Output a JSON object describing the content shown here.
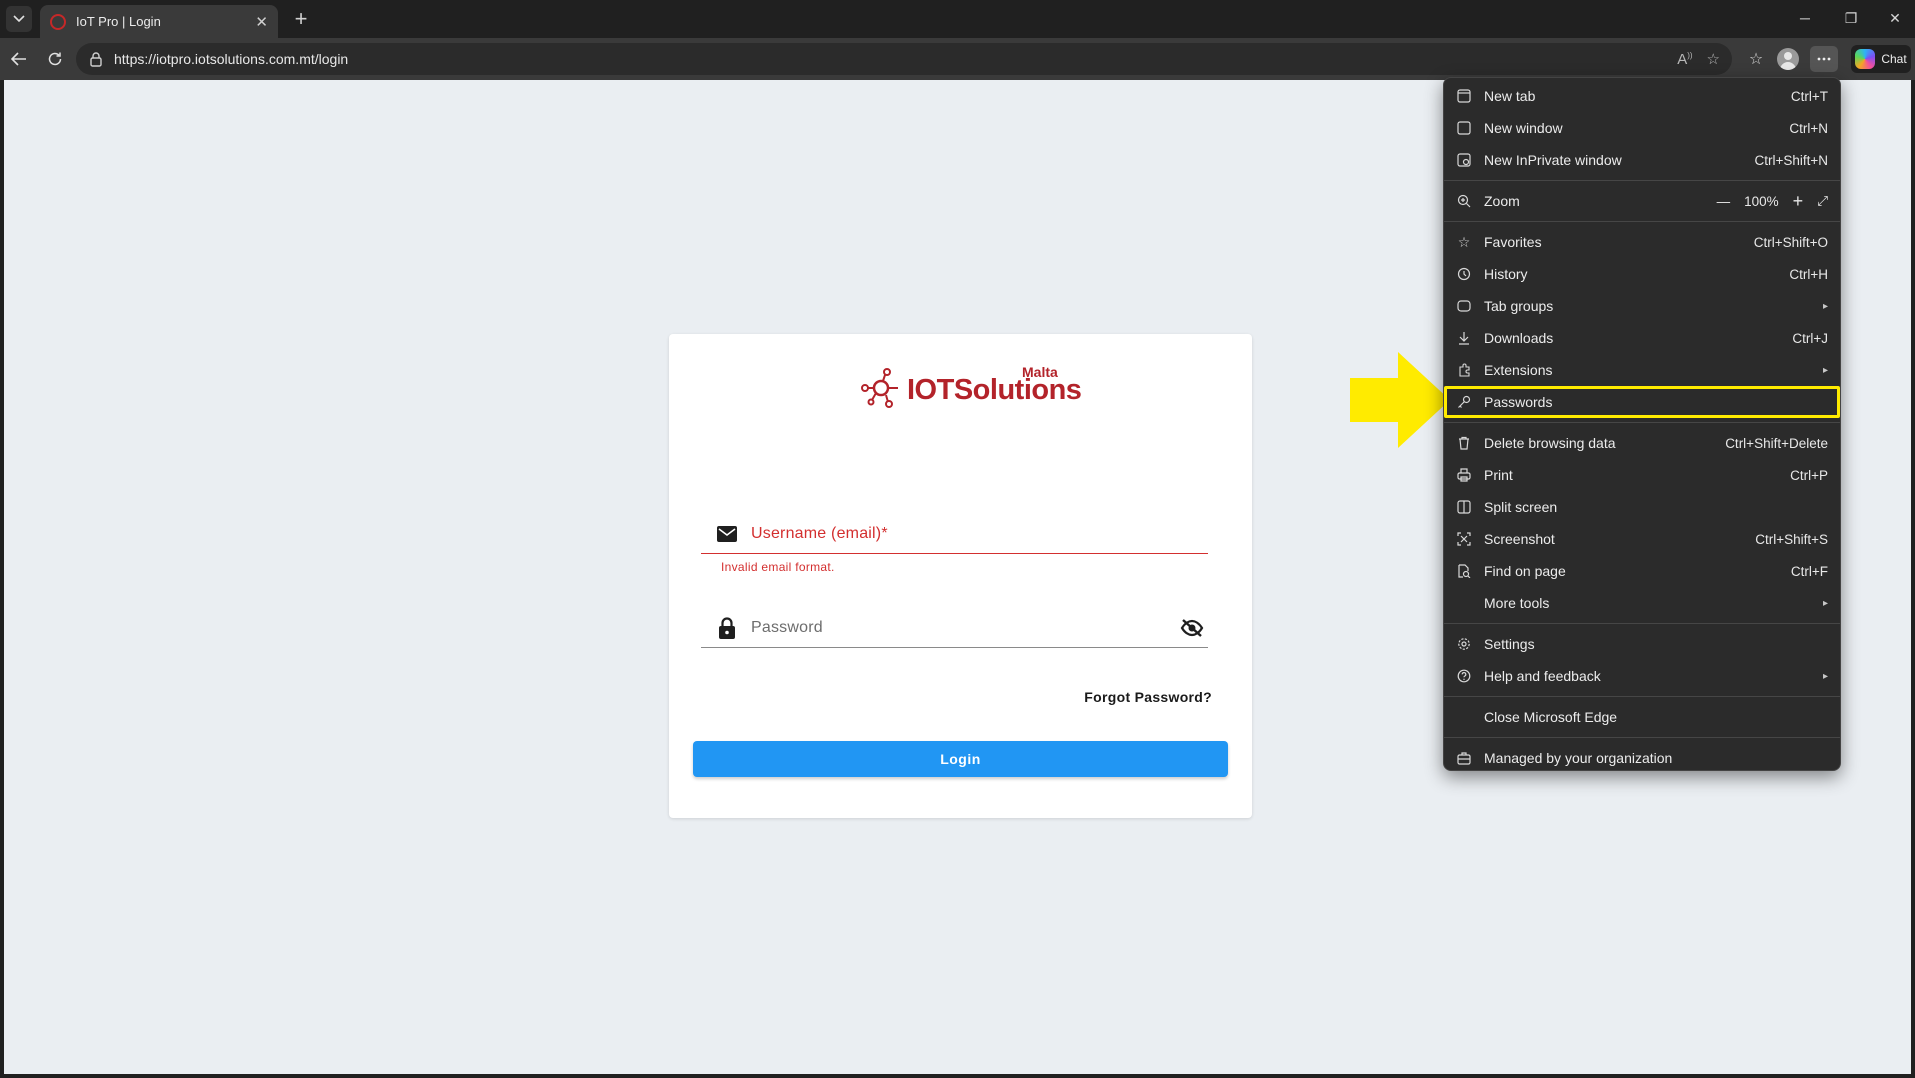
{
  "browser": {
    "tab_title": "IoT Pro | Login",
    "tab_close": "✕",
    "new_tab": "+",
    "url": "https://iotpro.iotsolutions.com.mt/login",
    "chat_label": "Chat",
    "win_min": "─",
    "win_restore": "❐",
    "win_close": "✕"
  },
  "login": {
    "logo_text": "IOTSolutions",
    "logo_sub": "Malta",
    "username_label": "Username (email)*",
    "username_error": "Invalid email format.",
    "password_label": "Password",
    "forgot_label": "Forgot Password?",
    "login_button": "Login"
  },
  "menu": {
    "items_top": [
      {
        "label": "New tab",
        "shortcut": "Ctrl+T",
        "icon": "new-tab-icon"
      },
      {
        "label": "New window",
        "shortcut": "Ctrl+N",
        "icon": "new-window-icon"
      },
      {
        "label": "New InPrivate window",
        "shortcut": "Ctrl+Shift+N",
        "icon": "inprivate-icon"
      }
    ],
    "zoom": {
      "label": "Zoom",
      "value": "100%",
      "minus": "—",
      "plus": "+",
      "expand": "⤢"
    },
    "items_mid": [
      {
        "label": "Favorites",
        "shortcut": "Ctrl+Shift+O",
        "icon": "favorites-icon"
      },
      {
        "label": "History",
        "shortcut": "Ctrl+H",
        "icon": "history-icon"
      },
      {
        "label": "Tab groups",
        "shortcut": "",
        "icon": "tab-groups-icon",
        "submenu": true
      },
      {
        "label": "Downloads",
        "shortcut": "Ctrl+J",
        "icon": "downloads-icon"
      },
      {
        "label": "Extensions",
        "shortcut": "",
        "icon": "extensions-icon",
        "submenu": true
      },
      {
        "label": "Passwords",
        "shortcut": "",
        "icon": "key-icon",
        "highlighted": true
      }
    ],
    "items_tools": [
      {
        "label": "Delete browsing data",
        "shortcut": "Ctrl+Shift+Delete",
        "icon": "trash-icon"
      },
      {
        "label": "Print",
        "shortcut": "Ctrl+P",
        "icon": "print-icon"
      },
      {
        "label": "Split screen",
        "shortcut": "",
        "icon": "split-screen-icon"
      },
      {
        "label": "Screenshot",
        "shortcut": "Ctrl+Shift+S",
        "icon": "screenshot-icon"
      },
      {
        "label": "Find on page",
        "shortcut": "Ctrl+F",
        "icon": "find-icon"
      },
      {
        "label": "More tools",
        "shortcut": "",
        "icon": "",
        "submenu": true
      }
    ],
    "items_settings": [
      {
        "label": "Settings",
        "shortcut": "",
        "icon": "gear-icon"
      },
      {
        "label": "Help and feedback",
        "shortcut": "",
        "icon": "help-icon",
        "submenu": true
      }
    ],
    "close_edge": "Close Microsoft Edge",
    "managed": "Managed by your organization",
    "submenu_arrow": "▸"
  },
  "colors": {
    "highlight": "#ffeb00",
    "error": "#d32f2f",
    "primary": "#2196f3",
    "brand": "#b3232a"
  }
}
